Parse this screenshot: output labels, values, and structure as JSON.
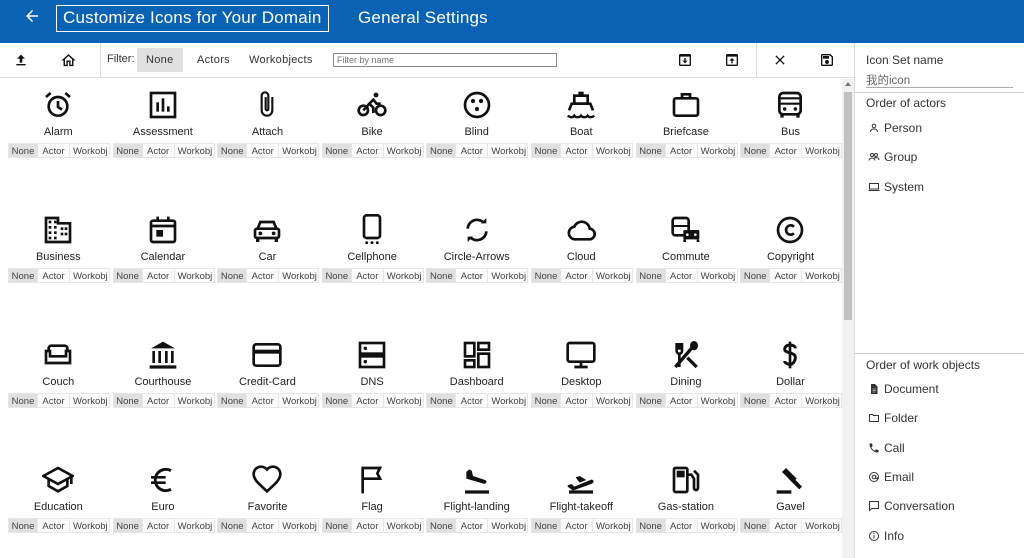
{
  "header": {
    "title": "Customize Icons for Your Domain",
    "subtitle": "General Settings"
  },
  "toolbar": {
    "filter_label": "Filter:",
    "filters": [
      "None",
      "Actors",
      "Workobjects"
    ],
    "active_filter": "None",
    "search_placeholder": "Filter by name"
  },
  "icon_options": [
    "None",
    "Actor",
    "Workobj"
  ],
  "icons": [
    {
      "name": "Alarm",
      "icon": "alarm-icon"
    },
    {
      "name": "Assessment",
      "icon": "assessment-icon"
    },
    {
      "name": "Attach",
      "icon": "attach-icon"
    },
    {
      "name": "Bike",
      "icon": "bike-icon"
    },
    {
      "name": "Blind",
      "icon": "blind-icon"
    },
    {
      "name": "Boat",
      "icon": "boat-icon"
    },
    {
      "name": "Briefcase",
      "icon": "briefcase-icon"
    },
    {
      "name": "Bus",
      "icon": "bus-icon"
    },
    {
      "name": "Business",
      "icon": "business-icon"
    },
    {
      "name": "Calendar",
      "icon": "calendar-icon"
    },
    {
      "name": "Car",
      "icon": "car-icon"
    },
    {
      "name": "Cellphone",
      "icon": "cellphone-icon"
    },
    {
      "name": "Circle-Arrows",
      "icon": "circle-arrows-icon"
    },
    {
      "name": "Cloud",
      "icon": "cloud-icon"
    },
    {
      "name": "Commute",
      "icon": "commute-icon"
    },
    {
      "name": "Copyright",
      "icon": "copyright-icon"
    },
    {
      "name": "Couch",
      "icon": "couch-icon"
    },
    {
      "name": "Courthouse",
      "icon": "courthouse-icon"
    },
    {
      "name": "Credit-Card",
      "icon": "credit-card-icon"
    },
    {
      "name": "DNS",
      "icon": "dns-icon"
    },
    {
      "name": "Dashboard",
      "icon": "dashboard-icon"
    },
    {
      "name": "Desktop",
      "icon": "desktop-icon"
    },
    {
      "name": "Dining",
      "icon": "dining-icon"
    },
    {
      "name": "Dollar",
      "icon": "dollar-icon"
    },
    {
      "name": "Education",
      "icon": "education-icon"
    },
    {
      "name": "Euro",
      "icon": "euro-icon"
    },
    {
      "name": "Favorite",
      "icon": "favorite-icon"
    },
    {
      "name": "Flag",
      "icon": "flag-icon"
    },
    {
      "name": "Flight-landing",
      "icon": "flight-landing-icon"
    },
    {
      "name": "Flight-takeoff",
      "icon": "flight-takeoff-icon"
    },
    {
      "name": "Gas-station",
      "icon": "gas-station-icon"
    },
    {
      "name": "Gavel",
      "icon": "gavel-icon"
    }
  ],
  "right_panel": {
    "icon_set_label": "Icon Set name",
    "icon_set_value": "我的icon",
    "actors_label": "Order of actors",
    "actors": [
      {
        "label": "Person",
        "icon": "person-icon"
      },
      {
        "label": "Group",
        "icon": "group-icon"
      },
      {
        "label": "System",
        "icon": "system-icon"
      }
    ],
    "workobjects_label": "Order of work objects",
    "workobjects": [
      {
        "label": "Document",
        "icon": "document-icon"
      },
      {
        "label": "Folder",
        "icon": "folder-icon"
      },
      {
        "label": "Call",
        "icon": "call-icon"
      },
      {
        "label": "Email",
        "icon": "email-icon"
      },
      {
        "label": "Conversation",
        "icon": "conversation-icon"
      },
      {
        "label": "Info",
        "icon": "info-icon"
      }
    ]
  },
  "colors": {
    "header_bg": "#0a62b4",
    "selected_bg": "#e0e0e0"
  }
}
